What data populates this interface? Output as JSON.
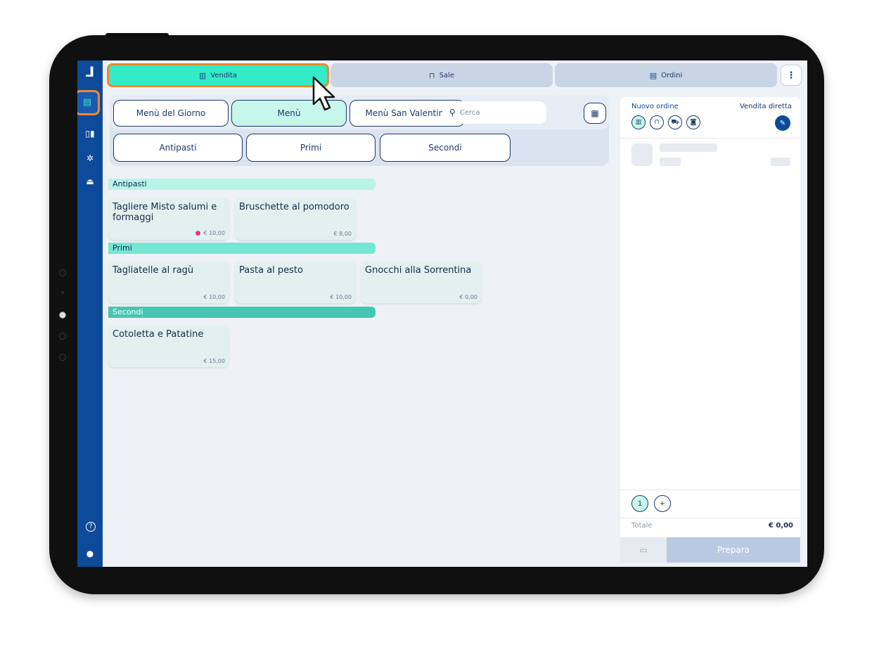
{
  "app": {
    "logo": "ꟷ",
    "logo_text": "ʮ"
  },
  "rail": {
    "items": [
      {
        "icon": "cash-register-icon",
        "glyph": "▤"
      },
      {
        "icon": "bar-chart-icon",
        "glyph": "▯▮"
      },
      {
        "icon": "settings-gear-icon",
        "glyph": "✲"
      },
      {
        "icon": "logout-icon",
        "glyph": "⏏"
      }
    ],
    "bottom": [
      {
        "icon": "help-icon",
        "glyph": "?"
      },
      {
        "icon": "user-icon",
        "glyph": "●"
      }
    ]
  },
  "tabs": [
    {
      "label": "Vendita",
      "icon": "receipt-icon",
      "glyph": "▥",
      "active": true
    },
    {
      "label": "Sale",
      "icon": "armchair-icon",
      "glyph": "⊓"
    },
    {
      "label": "Ordini",
      "icon": "list-icon",
      "glyph": "▤"
    }
  ],
  "more_glyph": "⋮",
  "menus": [
    {
      "label": "Menù del Giorno"
    },
    {
      "label": "Menù",
      "active": true
    },
    {
      "label": "Menù San Valentino"
    }
  ],
  "search": {
    "placeholder": "Cerca"
  },
  "calc_glyph": "▦",
  "categories_tabs": [
    "Antipasti",
    "Primi",
    "Secondi"
  ],
  "sections": [
    {
      "name": "Antipasti",
      "color": "#b8f3e7",
      "items": [
        {
          "name": "Tagliere Misto salumi e formaggi",
          "price": "€ 10,00",
          "dot": true
        },
        {
          "name": "Bruschette al pomodoro",
          "price": "€ 8,00"
        }
      ]
    },
    {
      "name": "Primi",
      "color": "#74e6d2",
      "items": [
        {
          "name": "Tagliatelle al ragù",
          "price": "€ 10,00"
        },
        {
          "name": "Pasta al pesto",
          "price": "€ 10,00"
        },
        {
          "name": "Gnocchi alla Sorrentina",
          "price": "€ 0,00"
        }
      ]
    },
    {
      "name": "Secondi",
      "color": "#46c6b3",
      "items": [
        {
          "name": "Cotoletta e Patatine",
          "price": "€ 15,00"
        }
      ]
    }
  ],
  "order": {
    "title": "Nuovo ordine",
    "mode": "Vendita diretta",
    "type_icons": [
      {
        "icon": "receipt-icon",
        "glyph": "▥",
        "active": true
      },
      {
        "icon": "armchair-icon",
        "glyph": "⊓"
      },
      {
        "icon": "delivery-icon",
        "glyph": "⛟"
      },
      {
        "icon": "bag-icon",
        "glyph": "◙"
      }
    ],
    "edit_glyph": "✎",
    "qty_label": "1",
    "add_label": "+",
    "total_label": "Totale",
    "total_value": "€ 0,00",
    "pay_glyph": "▭",
    "prepare_label": "Prepara"
  }
}
